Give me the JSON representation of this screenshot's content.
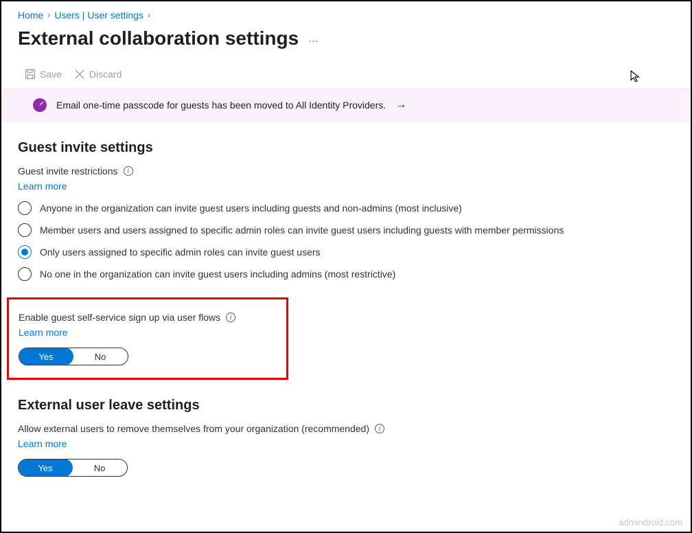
{
  "breadcrumb": {
    "home": "Home",
    "users": "Users | User settings"
  },
  "page_title": "External collaboration settings",
  "toolbar": {
    "save": "Save",
    "discard": "Discard"
  },
  "banner": {
    "message": "Email one-time passcode for guests has been moved to All Identity Providers."
  },
  "guest_invite": {
    "heading": "Guest invite settings",
    "restrictions_label": "Guest invite restrictions",
    "learn_more": "Learn more",
    "options": [
      "Anyone in the organization can invite guest users including guests and non-admins (most inclusive)",
      "Member users and users assigned to specific admin roles can invite guest users including guests with member permissions",
      "Only users assigned to specific admin roles can invite guest users",
      "No one in the organization can invite guest users including admins (most restrictive)"
    ],
    "selected_index": 2
  },
  "self_service": {
    "label": "Enable guest self-service sign up via user flows",
    "learn_more": "Learn more",
    "yes": "Yes",
    "no": "No",
    "value": "Yes"
  },
  "leave_settings": {
    "heading": "External user leave settings",
    "label": "Allow external users to remove themselves from your organization (recommended)",
    "learn_more": "Learn more",
    "yes": "Yes",
    "no": "No",
    "value": "Yes"
  },
  "watermark": "admindroid.com"
}
